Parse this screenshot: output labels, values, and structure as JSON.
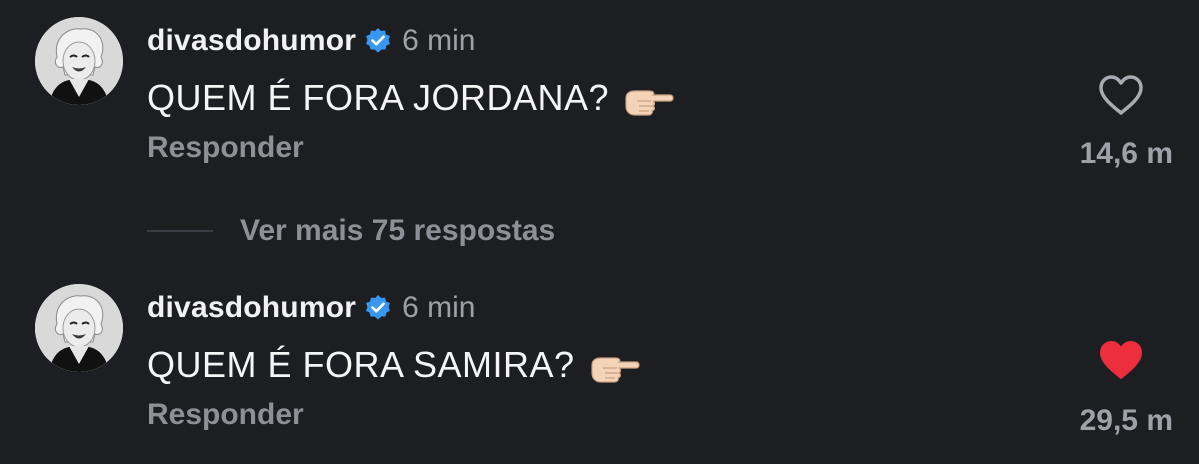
{
  "comments": [
    {
      "username": "divasdohumor",
      "time": "6 min",
      "text": "QUEM É FORA JORDANA?",
      "reply_label": "Responder",
      "likes": "14,6 m",
      "liked": false
    },
    {
      "username": "divasdohumor",
      "time": "6 min",
      "text": "QUEM É FORA SAMIRA?",
      "reply_label": "Responder",
      "likes": "29,5 m",
      "liked": true
    }
  ],
  "view_replies": "Ver mais 75 respostas",
  "colors": {
    "background": "#1c1e22",
    "verified": "#3897f0",
    "like_active": "#ed2e3c",
    "like_inactive": "#a8abb1"
  },
  "icons": {
    "avatar": "avatar",
    "verified": "verified-badge-icon",
    "pointer": "backhand-index-pointing-right-icon",
    "like": "heart-icon"
  }
}
